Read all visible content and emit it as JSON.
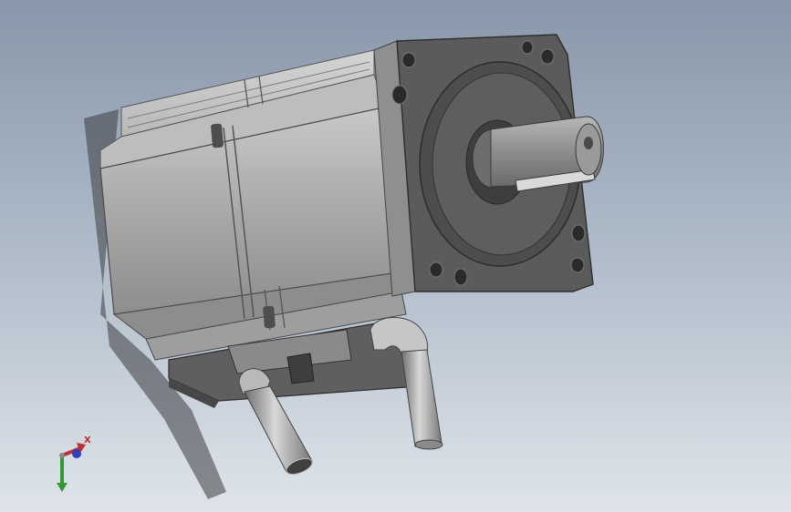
{
  "viewport": {
    "background_top": "#8897aa",
    "background_bottom": "#dfe4ea"
  },
  "model": {
    "body_color": "#a6a6a6",
    "flange_color": "#595959",
    "shaft_color": "#8c8c8c"
  },
  "triad": {
    "x_label": "X",
    "x_color": "#c0312b",
    "y_color": "#2f9a33",
    "z_color": "#2b3fc0"
  }
}
